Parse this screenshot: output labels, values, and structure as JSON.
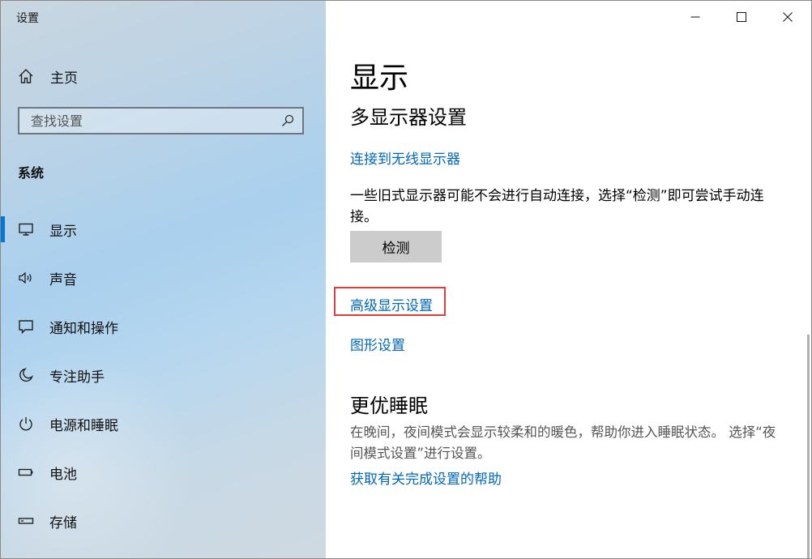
{
  "window": {
    "title": "设置"
  },
  "sidebar": {
    "home_label": "主页",
    "search_placeholder": "查找设置",
    "section_label": "系统",
    "items": [
      {
        "label": "显示",
        "icon": "monitor-icon",
        "selected": true
      },
      {
        "label": "声音",
        "icon": "speaker-icon",
        "selected": false
      },
      {
        "label": "通知和操作",
        "icon": "notification-icon",
        "selected": false
      },
      {
        "label": "专注助手",
        "icon": "moon-icon",
        "selected": false
      },
      {
        "label": "电源和睡眠",
        "icon": "power-icon",
        "selected": false
      },
      {
        "label": "电池",
        "icon": "battery-icon",
        "selected": false
      },
      {
        "label": "存储",
        "icon": "storage-icon",
        "selected": false
      }
    ]
  },
  "main": {
    "page_title": "显示",
    "multi_display_heading": "多显示器设置",
    "wireless_link": "连接到无线显示器",
    "detect_description": "一些旧式显示器可能不会进行自动连接，选择“检测”即可尝试手动连接。",
    "detect_button": "检测",
    "advanced_link": "高级显示设置",
    "graphics_link": "图形设置",
    "sleep_heading": "更优睡眠",
    "sleep_description": "在晚间，夜间模式会显示较柔和的暖色，帮助你进入睡眠状态。 选择“夜间模式设置”进行设置。",
    "help_link": "获取有关完成设置的帮助"
  },
  "colors": {
    "accent": "#0078d7",
    "link": "#0067b8",
    "highlight_border": "#d9403d",
    "button_bg": "#cccccc"
  }
}
